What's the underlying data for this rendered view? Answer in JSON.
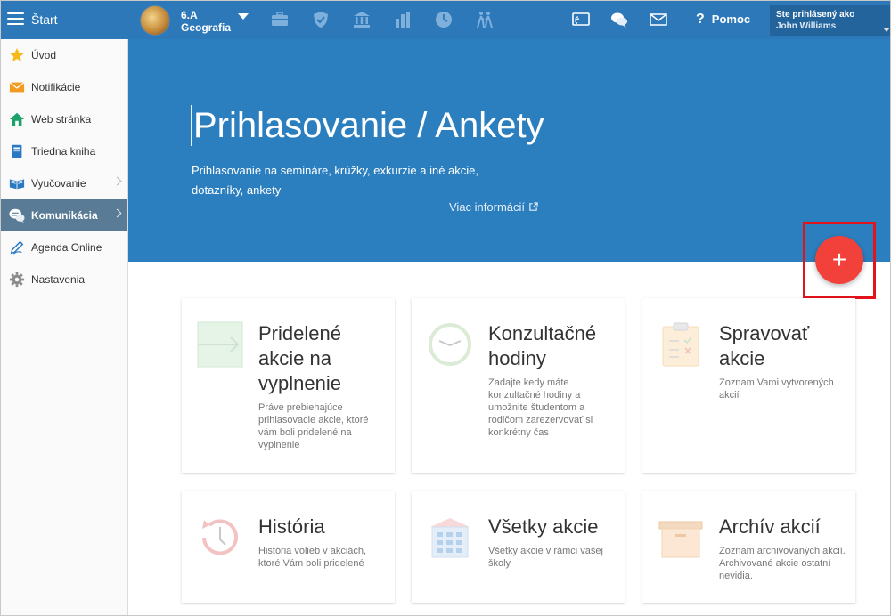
{
  "topbar": {
    "start_label": "Štart",
    "class_name": "6.A",
    "class_subject": "Geografia",
    "icons": [
      "briefcase-icon",
      "shield-icon",
      "bank-icon",
      "bar-chart-icon",
      "clock-icon",
      "students-walking-icon"
    ],
    "right_icons": [
      "tv-cast-icon",
      "chat-icon",
      "mail-icon"
    ],
    "help_label": "Pomoc",
    "logged_in_label": "Ste prihlásený ako",
    "user_name": "John Williams"
  },
  "sidebar": {
    "items": [
      {
        "label": "Úvod",
        "icon": "star-icon"
      },
      {
        "label": "Notifikácie",
        "icon": "envelope-icon"
      },
      {
        "label": "Web stránka",
        "icon": "house-icon"
      },
      {
        "label": "Triedna kniha",
        "icon": "book-icon"
      },
      {
        "label": "Vyučovanie",
        "icon": "open-book-icon"
      },
      {
        "label": "Komunikácia",
        "icon": "chat-bubbles-icon"
      },
      {
        "label": "Agenda Online",
        "icon": "pencil-icon"
      },
      {
        "label": "Nastavenia",
        "icon": "gear-icon"
      }
    ]
  },
  "hero": {
    "title": "Prihlasovanie / Ankety",
    "description_line1": "Prihlasovanie na semináre, krúžky, exkurzie a iné akcie,",
    "description_line2": "dotazníky, ankety",
    "more_info": "Viac informácií"
  },
  "add_button": {
    "label": "+"
  },
  "cards": [
    {
      "title": "Pridelené akcie na vyplnenie",
      "desc": "Práve prebiehajúce prihlasovacie akcie, ktoré vám boli pridelené na vyplnenie"
    },
    {
      "title": "Konzultačné hodiny",
      "desc": "Zadajte kedy máte konzultačné hodiny a umožnite študentom a rodičom zarezervovať si konkrétny čas"
    },
    {
      "title": "Spravovať akcie",
      "desc": "Zoznam Vami vytvorených akcií"
    },
    {
      "title": "História",
      "desc": "História volieb v akciách, ktoré Vám boli pridelené"
    },
    {
      "title": "Všetky akcie",
      "desc": "Všetky akcie v rámci vašej školy"
    },
    {
      "title": "Archív akcií",
      "desc": "Zoznam archivovaných akcií. Archivované akcie ostatní nevidia."
    }
  ]
}
